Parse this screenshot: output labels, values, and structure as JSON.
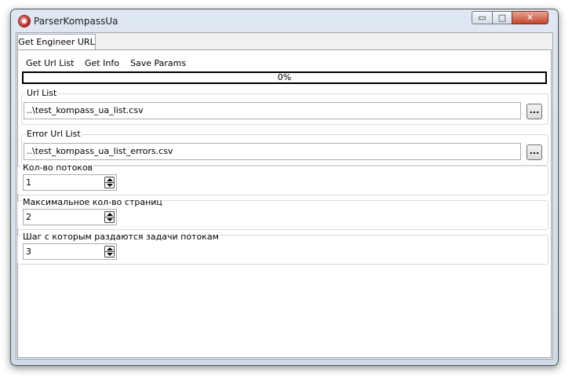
{
  "window": {
    "title": "ParserKompassUa",
    "min_glyph": "▭",
    "max_glyph": "□",
    "close_glyph": "✕"
  },
  "tabs": [
    {
      "label": "Get Engineer URL",
      "active": true
    }
  ],
  "menu": {
    "items": [
      "Get Url List",
      "Get Info",
      "Save Params"
    ]
  },
  "progress": {
    "value": 0,
    "text": "0%"
  },
  "url_list": {
    "label": "Url List",
    "value": "..\\test_kompass_ua_list.csv",
    "button": "..."
  },
  "error_url_list": {
    "label": "Error Url List",
    "value": "..\\test_kompass_ua_list_errors.csv",
    "button": "..."
  },
  "threads": {
    "label": "Кол-во потоков",
    "value": "1"
  },
  "max_pages": {
    "label": "Максимальное кол-во страниц",
    "value": "2"
  },
  "step": {
    "label": "Шаг с которым раздаются задачи потокам",
    "value": "3"
  },
  "colors": {
    "progress_fill": "#3a9d3a",
    "close_button": "#c6452e"
  },
  "icons": {
    "app": "app-logo-icon"
  }
}
